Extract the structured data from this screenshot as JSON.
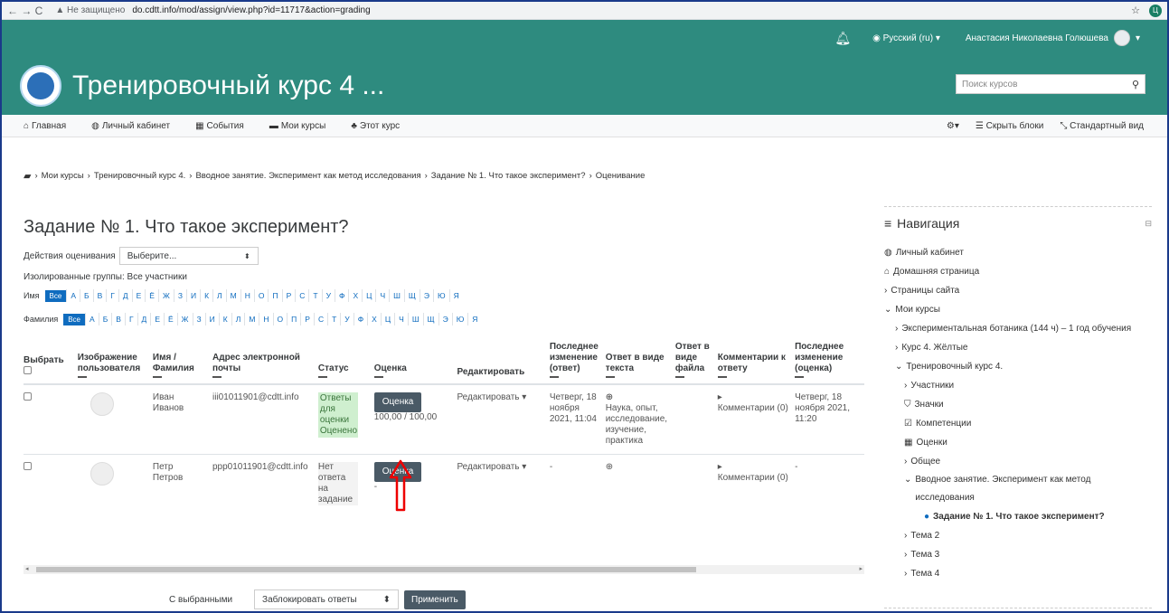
{
  "browser": {
    "nav": "← → C",
    "warning": "▲ Не защищено",
    "url": "do.cdtt.info/mod/assign/view.php?id=11717&action=grading",
    "star": "☆",
    "profile": "Ц"
  },
  "topbar": {
    "language": "Русский (ru)",
    "user": "Анастасия Николаевна Голюшева"
  },
  "header": {
    "course_title": "Тренировочный курс 4 ...",
    "search_placeholder": "Поиск курсов"
  },
  "navbar": {
    "items": [
      "Главная",
      "Личный кабинет",
      "События",
      "Мои курсы",
      "Этот курс"
    ],
    "hide_blocks": "Скрыть блоки",
    "standard_view": "Стандартный вид"
  },
  "breadcrumb": {
    "items": [
      "Мои курсы",
      "Тренировочный курс 4.",
      "Вводное занятие. Эксперимент как метод исследования",
      "Задание № 1. Что такое эксперимент?",
      "Оценивание"
    ]
  },
  "main": {
    "title": "Задание № 1. Что такое эксперимент?",
    "grading_actions_label": "Действия оценивания",
    "grading_actions_value": "Выберите...",
    "groups": "Изолированные группы: Все участники",
    "firstname_label": "Имя",
    "lastname_label": "Фамилия",
    "all": "Все",
    "letters": [
      "А",
      "Б",
      "В",
      "Г",
      "Д",
      "Е",
      "Ё",
      "Ж",
      "З",
      "И",
      "К",
      "Л",
      "М",
      "Н",
      "О",
      "П",
      "Р",
      "С",
      "Т",
      "У",
      "Ф",
      "Х",
      "Ц",
      "Ч",
      "Ш",
      "Щ",
      "Э",
      "Ю",
      "Я"
    ]
  },
  "table": {
    "headers": {
      "select": "Выбрать",
      "picture": "Изображение пользователя",
      "name": "Имя / Фамилия",
      "email": "Адрес электронной почты",
      "status": "Статус",
      "grade": "Оценка",
      "edit": "Редактировать",
      "last_modified": "Последнее изменение (ответ)",
      "text_answer": "Ответ в виде текста",
      "file_answer": "Ответ в виде файла",
      "comments": "Комментарии к ответу",
      "last_modified_grade": "Последнее изменение (оценка)"
    },
    "rows": [
      {
        "first": "Иван",
        "last": "Иванов",
        "email": "iii01011901@cdtt.info",
        "status": "Ответы для оценки Оценено",
        "grade_button": "Оценка",
        "grade_value": "100,00 / 100,00",
        "edit": "Редактировать",
        "modified": "Четверг, 18 ноября 2021, 11:04",
        "text": "Наука, опыт, исследование, изучение, практика",
        "comments": "Комментарии (0)",
        "graded": "Четверг, 18 ноября 2021, 11:20"
      },
      {
        "first": "Петр",
        "last": "Петров",
        "email": "ppp01011901@cdtt.info",
        "status": "Нет ответа на задание",
        "grade_button": "Оценка",
        "grade_value": "-",
        "edit": "Редактировать",
        "modified": "-",
        "text": "",
        "comments": "Комментарии (0)",
        "graded": "-"
      }
    ]
  },
  "bottom": {
    "with_selected": "С выбранными",
    "action": "Заблокировать ответы",
    "apply": "Применить"
  },
  "sidebar": {
    "title": "Навигация",
    "items": {
      "dashboard": "Личный кабинет",
      "home": "Домашняя страница",
      "site_pages": "Страницы сайта",
      "my_courses": "Мои курсы",
      "botany": "Экспериментальная ботаника (144 ч) – 1 год обучения",
      "course4_yellow": "Курс 4. Жёлтые",
      "course4": "Тренировочный курс 4.",
      "participants": "Участники",
      "badges": "Значки",
      "competencies": "Компетенции",
      "grades": "Оценки",
      "general": "Общее",
      "intro": "Вводное занятие. Эксперимент как метод исследования",
      "task1": "Задание № 1. Что такое эксперимент?",
      "topic2": "Тема 2",
      "topic3": "Тема 3",
      "topic4": "Тема 4"
    }
  }
}
